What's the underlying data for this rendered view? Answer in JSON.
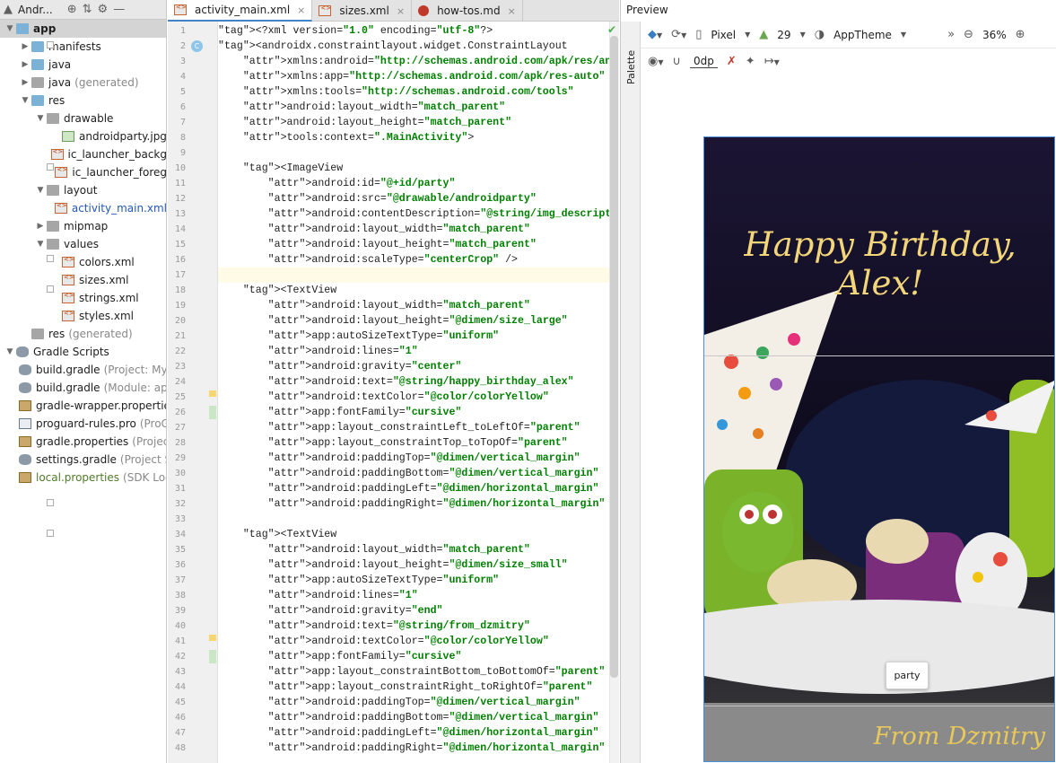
{
  "project": {
    "title": "Andr...",
    "rows": [
      {
        "label": "app",
        "note": ""
      },
      {
        "label": "manifests",
        "note": ""
      },
      {
        "label": "java",
        "note": ""
      },
      {
        "label": "java",
        "note": "(generated)"
      },
      {
        "label": "res",
        "note": ""
      },
      {
        "label": "drawable",
        "note": ""
      },
      {
        "label": "androidparty.jpg",
        "note": ""
      },
      {
        "label": "ic_launcher_backg",
        "note": ""
      },
      {
        "label": "ic_launcher_foreg",
        "note": ""
      },
      {
        "label": "layout",
        "note": ""
      },
      {
        "label": "activity_main.xml",
        "note": ""
      },
      {
        "label": "mipmap",
        "note": ""
      },
      {
        "label": "values",
        "note": ""
      },
      {
        "label": "colors.xml",
        "note": ""
      },
      {
        "label": "sizes.xml",
        "note": ""
      },
      {
        "label": "strings.xml",
        "note": ""
      },
      {
        "label": "styles.xml",
        "note": ""
      },
      {
        "label": "res",
        "note": "(generated)"
      },
      {
        "label": "Gradle Scripts",
        "note": ""
      },
      {
        "label": "build.gradle",
        "note": "(Project: My"
      },
      {
        "label": "build.gradle",
        "note": "(Module: ap"
      },
      {
        "label": "gradle-wrapper.propertie",
        "note": ""
      },
      {
        "label": "proguard-rules.pro",
        "note": "(ProG"
      },
      {
        "label": "gradle.properties",
        "note": "(Project"
      },
      {
        "label": "settings.gradle",
        "note": "(Project S"
      },
      {
        "label": "local.properties",
        "note": "(SDK Loc"
      }
    ]
  },
  "tabs": [
    {
      "label": "activity_main.xml"
    },
    {
      "label": "sizes.xml"
    },
    {
      "label": "how-tos.md"
    }
  ],
  "editor": {
    "line_numbers": [
      "1",
      "2",
      "3",
      "4",
      "5",
      "6",
      "7",
      "8",
      "9",
      "10",
      "11",
      "12",
      "13",
      "14",
      "15",
      "16",
      "17",
      "18",
      "19",
      "20",
      "21",
      "22",
      "23",
      "24",
      "25",
      "26",
      "27",
      "28",
      "29",
      "30",
      "31",
      "32",
      "33",
      "34",
      "35",
      "36",
      "37",
      "38",
      "39",
      "40",
      "41",
      "42",
      "43",
      "44",
      "45",
      "46",
      "47",
      "48"
    ],
    "lines": [
      "<?xml version=\"1.0\" encoding=\"utf-8\"?>",
      "<androidx.constraintlayout.widget.ConstraintLayout",
      "    xmlns:android=\"http://schemas.android.com/apk/res/android\"",
      "    xmlns:app=\"http://schemas.android.com/apk/res-auto\"",
      "    xmlns:tools=\"http://schemas.android.com/tools\"",
      "    android:layout_width=\"match_parent\"",
      "    android:layout_height=\"match_parent\"",
      "    tools:context=\".MainActivity\">",
      "",
      "    <ImageView",
      "        android:id=\"@+id/party\"",
      "        android:src=\"@drawable/androidparty\"",
      "        android:contentDescription=\"@string/img_description\"",
      "        android:layout_width=\"match_parent\"",
      "        android:layout_height=\"match_parent\"",
      "        android:scaleType=\"centerCrop\" />",
      "",
      "    <TextView",
      "        android:layout_width=\"match_parent\"",
      "        android:layout_height=\"@dimen/size_large\"",
      "        app:autoSizeTextType=\"uniform\"",
      "        android:lines=\"1\"",
      "        android:gravity=\"center\"",
      "        android:text=\"@string/happy_birthday_alex\"",
      "        android:textColor=\"@color/colorYellow\"",
      "        app:fontFamily=\"cursive\"",
      "        app:layout_constraintLeft_toLeftOf=\"parent\"",
      "        app:layout_constraintTop_toTopOf=\"parent\"",
      "        android:paddingTop=\"@dimen/vertical_margin\"",
      "        android:paddingBottom=\"@dimen/vertical_margin\"",
      "        android:paddingLeft=\"@dimen/horizontal_margin\"",
      "        android:paddingRight=\"@dimen/horizontal_margin\" />",
      "",
      "    <TextView",
      "        android:layout_width=\"match_parent\"",
      "        android:layout_height=\"@dimen/size_small\"",
      "        app:autoSizeTextType=\"uniform\"",
      "        android:lines=\"1\"",
      "        android:gravity=\"end\"",
      "        android:text=\"@string/from_dzmitry\"",
      "        android:textColor=\"@color/colorYellow\"",
      "        app:fontFamily=\"cursive\"",
      "        app:layout_constraintBottom_toBottomOf=\"parent\"",
      "        app:layout_constraintRight_toRightOf=\"parent\"",
      "        android:paddingTop=\"@dimen/vertical_margin\"",
      "        android:paddingBottom=\"@dimen/vertical_margin\"",
      "        android:paddingLeft=\"@dimen/horizontal_margin\"",
      "        android:paddingRight=\"@dimen/horizontal_margin\" />"
    ]
  },
  "preview": {
    "title": "Preview",
    "palette_label": "Palette",
    "device": "Pixel",
    "api": "29",
    "theme": "AppTheme",
    "zoom": "36%",
    "margin_value": "0dp",
    "happy_text": "Happy Birthday, Alex!",
    "from_text": "From Dzmitry",
    "tooltip": "party",
    "text_color": "#f3d67a",
    "selection_color": "#4b8ed6"
  }
}
